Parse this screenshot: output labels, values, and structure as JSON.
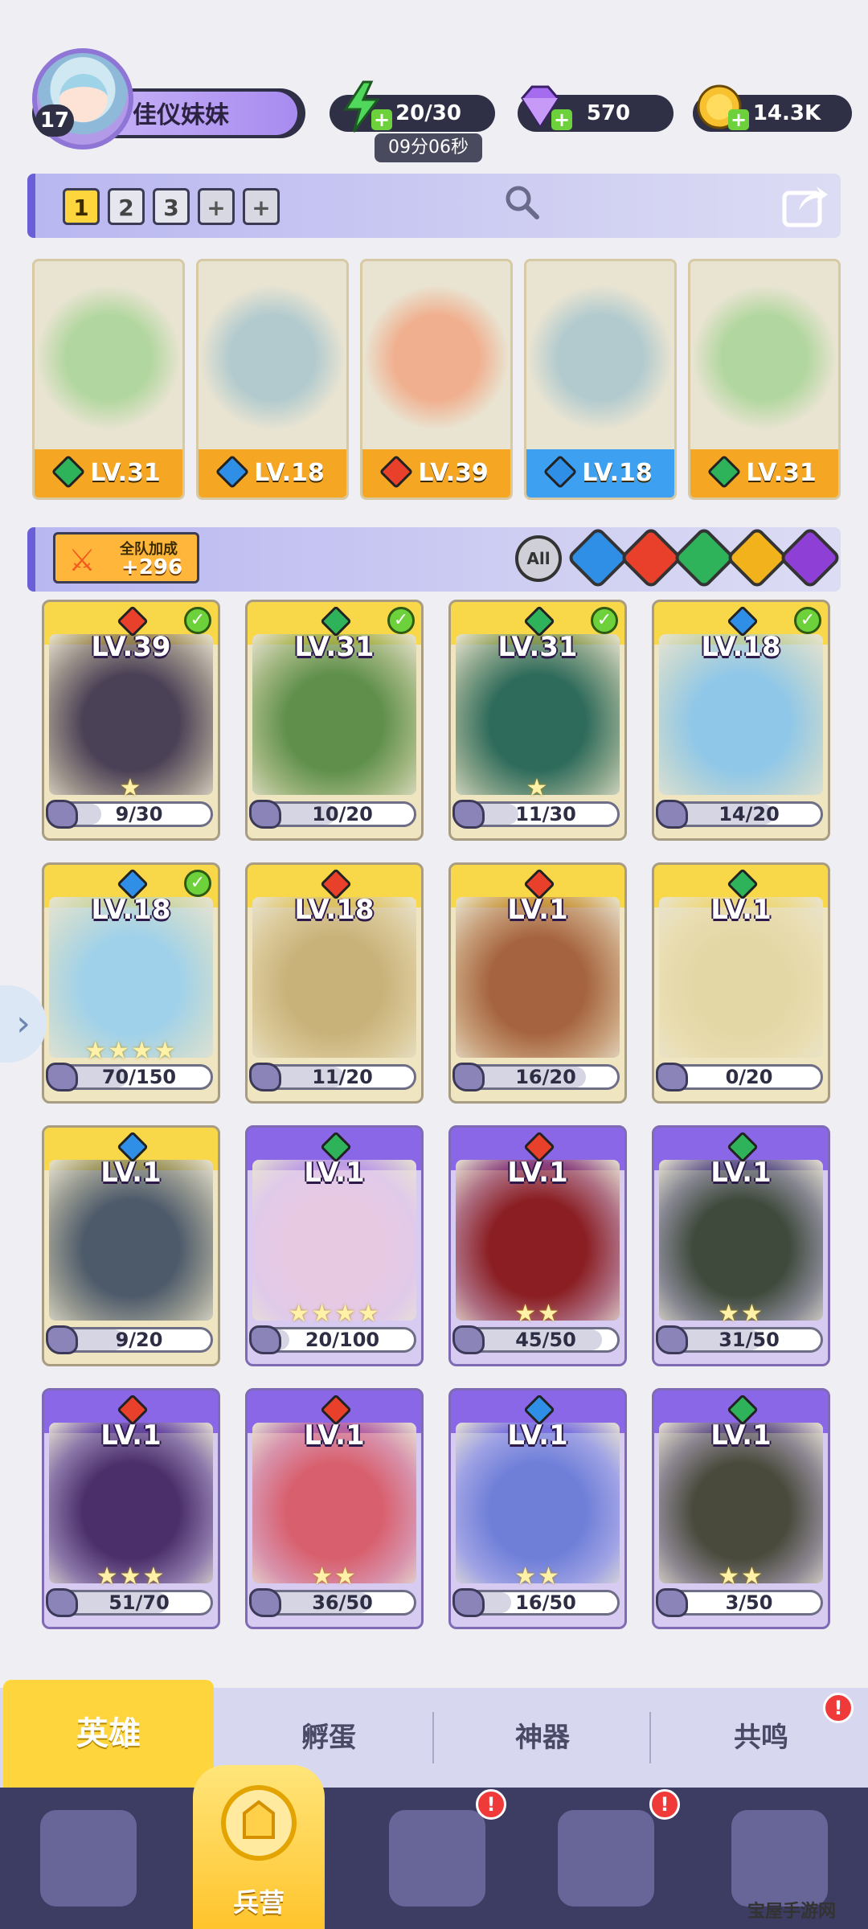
{
  "player": {
    "level": "17",
    "name": "佳仪妹妹"
  },
  "resources": {
    "energy": "20/30",
    "energy_timer": "09分06秒",
    "gems": "570",
    "coins": "14.3K"
  },
  "team_bar": {
    "slots": [
      "1",
      "2",
      "3",
      "+",
      "+"
    ]
  },
  "team": [
    {
      "level": "LV.31",
      "element": "wind",
      "color": "#f5a623"
    },
    {
      "level": "LV.18",
      "element": "water",
      "color": "#f5a623"
    },
    {
      "level": "LV.39",
      "element": "fire",
      "color": "#f5a623"
    },
    {
      "level": "LV.18",
      "element": "water",
      "color": "#3ea0f0"
    },
    {
      "level": "LV.31",
      "element": "wind",
      "color": "#f5a623"
    }
  ],
  "bonus": {
    "title": "全队加成",
    "value": "+296"
  },
  "filters": {
    "all_label": "All",
    "elements": [
      "water",
      "fire",
      "wind",
      "light",
      "dark"
    ]
  },
  "element_colors": {
    "fire": "#e8402a",
    "water": "#2f8fe6",
    "wind": "#2fb35a",
    "light": "#f2b21b",
    "dark": "#8d3fd6"
  },
  "heroes": [
    {
      "level": "LV.39",
      "element": "fire",
      "progress": "9/30",
      "owned": true,
      "stars": 1,
      "rarity": "gold",
      "art": "#4b4156"
    },
    {
      "level": "LV.31",
      "element": "wind",
      "progress": "10/20",
      "owned": true,
      "stars": 0,
      "rarity": "gold",
      "art": "#5f8f4b"
    },
    {
      "level": "LV.31",
      "element": "wind",
      "progress": "11/30",
      "owned": true,
      "stars": 1,
      "rarity": "gold",
      "art": "#2f6b5b"
    },
    {
      "level": "LV.18",
      "element": "water",
      "progress": "14/20",
      "owned": true,
      "stars": 0,
      "rarity": "gold",
      "art": "#8fc7e8"
    },
    {
      "level": "LV.18",
      "element": "water",
      "progress": "70/150",
      "owned": true,
      "stars": 4,
      "rarity": "gold",
      "art": "#9fd1ea"
    },
    {
      "level": "LV.18",
      "element": "fire",
      "progress": "11/20",
      "owned": false,
      "stars": 0,
      "rarity": "gold",
      "art": "#c9b27a"
    },
    {
      "level": "LV.1",
      "element": "fire",
      "progress": "16/20",
      "owned": false,
      "stars": 0,
      "rarity": "gold",
      "art": "#a5643f"
    },
    {
      "level": "LV.1",
      "element": "wind",
      "progress": "0/20",
      "owned": false,
      "stars": 0,
      "rarity": "gold",
      "art": "#e4d7a6"
    },
    {
      "level": "LV.1",
      "element": "water",
      "progress": "9/20",
      "owned": false,
      "stars": 0,
      "rarity": "gold",
      "art": "#4d5a6a"
    },
    {
      "level": "LV.1",
      "element": "wind",
      "progress": "20/100",
      "owned": false,
      "stars": 4,
      "rarity": "purple",
      "art": "#e8c9e2"
    },
    {
      "level": "LV.1",
      "element": "fire",
      "progress": "45/50",
      "owned": false,
      "stars": 2,
      "rarity": "purple",
      "art": "#8a1e22"
    },
    {
      "level": "LV.1",
      "element": "wind",
      "progress": "31/50",
      "owned": false,
      "stars": 2,
      "rarity": "purple",
      "art": "#3f4a3c"
    },
    {
      "level": "LV.1",
      "element": "fire",
      "progress": "51/70",
      "owned": false,
      "stars": 3,
      "rarity": "purple",
      "art": "#4b2f6a"
    },
    {
      "level": "LV.1",
      "element": "fire",
      "progress": "36/50",
      "owned": false,
      "stars": 2,
      "rarity": "purple",
      "art": "#d8606e"
    },
    {
      "level": "LV.1",
      "element": "water",
      "progress": "16/50",
      "owned": false,
      "stars": 2,
      "rarity": "purple",
      "art": "#6f7fd8"
    },
    {
      "level": "LV.1",
      "element": "wind",
      "progress": "3/50",
      "owned": false,
      "stars": 2,
      "rarity": "purple",
      "art": "#4a4a3c"
    }
  ],
  "sub_tabs": [
    "英雄",
    "孵蛋",
    "神器",
    "共鸣"
  ],
  "bottom_nav": {
    "center_label": "兵营"
  },
  "watermark": "宝屋手游网"
}
